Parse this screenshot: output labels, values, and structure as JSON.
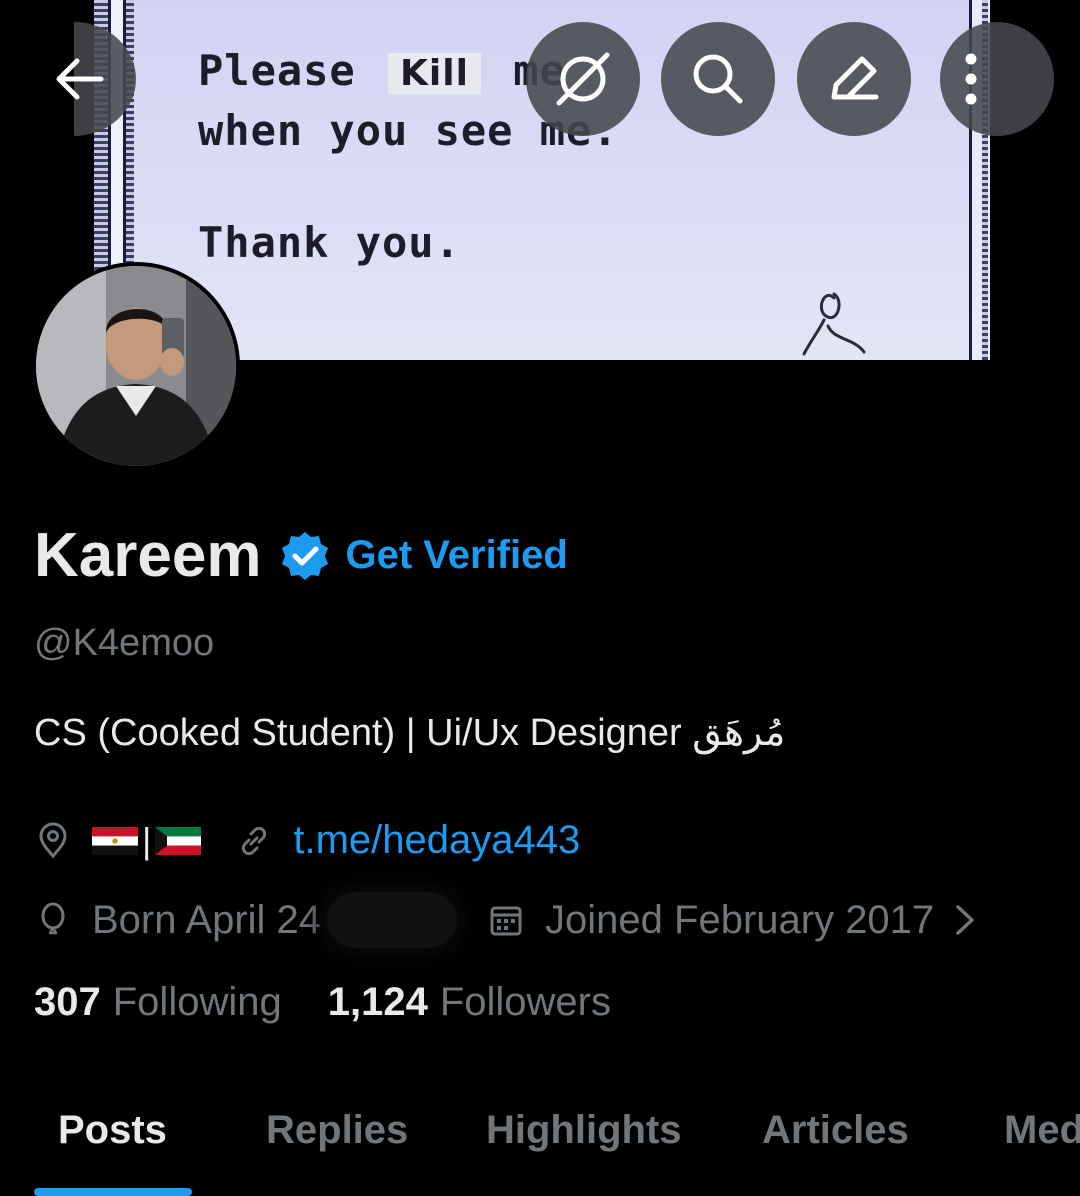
{
  "banner": {
    "line1_before": "Please ",
    "line1_kill": "Kill",
    "line1_after": " me",
    "line2": "when you see me.",
    "line3": "Thank you."
  },
  "toolbar": {
    "back_icon": "arrow-left-icon",
    "grok_icon": "grok-icon",
    "search_icon": "search-icon",
    "edit_icon": "edit-icon",
    "more_icon": "more-vertical-icon"
  },
  "profile": {
    "name": "Kareem",
    "get_verified": "Get Verified",
    "handle": "@K4emoo",
    "bio": "CS (Cooked Student) | Ui/Ux Designer  مُرهَق",
    "link": "t.me/hedaya443",
    "born": "Born April 24",
    "joined": "Joined February 2017"
  },
  "stats": {
    "following_count": "307",
    "following_label": "Following",
    "followers_count": "1,124",
    "followers_label": "Followers"
  },
  "tabs": [
    "Posts",
    "Replies",
    "Highlights",
    "Articles",
    "Med"
  ],
  "colors": {
    "accent": "#1d9bf0",
    "muted": "#71767b",
    "text": "#e7e9ea",
    "background": "#000000"
  }
}
